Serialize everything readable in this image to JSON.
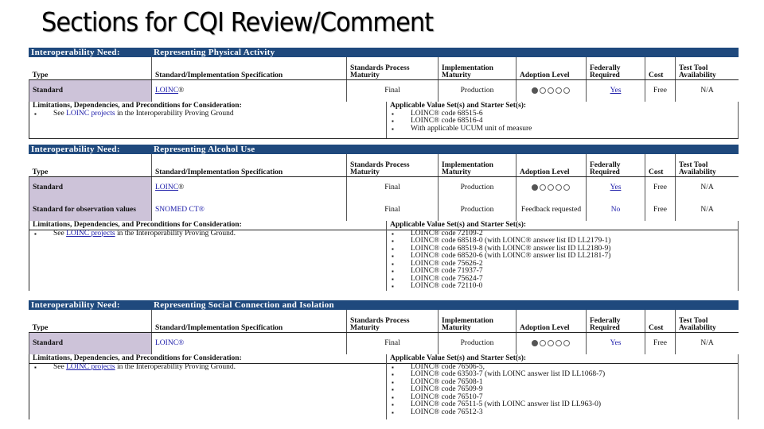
{
  "slide": {
    "title": "Sections for CQI Review/Comment"
  },
  "columns": [
    "Type",
    "Standard/Implementation Specification",
    "Standards Process Maturity",
    "Implementation Maturity",
    "Adoption Level",
    "Federally Required",
    "Cost",
    "Test Tool Availability"
  ],
  "limitations_header": "Limitations, Dependencies, and Preconditions for Consideration:",
  "value_sets_header": "Applicable Value Set(s) and Starter Set(s):",
  "colors": {
    "need_bar": "#1f497d",
    "type_cell": "#cdc3d9",
    "link": "#1a1aa8"
  },
  "sections": [
    {
      "need_label": "Interoperability Need:",
      "need_title": "Representing Physical Activity",
      "rows": [
        {
          "type": "Standard",
          "spec": "LOINC",
          "spec_suffix": "®",
          "process_maturity": "Final",
          "impl_maturity": "Production",
          "adoption": "1 of 5",
          "federally_required": "Yes",
          "cost": "Free",
          "test_tool": "N/A"
        }
      ],
      "limitations": [
        {
          "pre": "See ",
          "link": "LOINC projects",
          "post": " in the Interoperability Proving Ground"
        }
      ],
      "value_sets": [
        "LOINC® code 68515-6",
        "LOINC® code 68516-4",
        "With applicable UCUM unit of measure"
      ]
    },
    {
      "need_label": "Interoperability Need:",
      "need_title": "Representing Alcohol Use",
      "rows": [
        {
          "type": "Standard",
          "spec": "LOINC",
          "spec_suffix": "®",
          "process_maturity": "Final",
          "impl_maturity": "Production",
          "adoption": "1 of 5",
          "federally_required": "Yes",
          "cost": "Free",
          "test_tool": "N/A"
        },
        {
          "type": "Standard for observation values",
          "spec": "SNOMED CT®",
          "process_maturity": "Final",
          "impl_maturity": "Production",
          "adoption": "Feedback requested",
          "federally_required": "No",
          "cost": "Free",
          "test_tool": "N/A"
        }
      ],
      "limitations": [
        {
          "pre": "See ",
          "link": "LOINC projects",
          "post": " in the Interoperability Proving Ground."
        }
      ],
      "value_sets": [
        "LOINC® code 72109-2",
        "LOINC® code 68518-0 (with LOINC® answer list ID LL2179-1)",
        "LOINC® code 68519-8 (with LOINC® answer list ID LL2180-9)",
        "LOINC® code 68520-6 (with LOINC® answer list ID LL2181-7)",
        "LOINC® code 75626-2",
        "LOINC® code 71937-7",
        "LOINC® code 75624-7",
        "LOINC® code 72110-0"
      ]
    },
    {
      "need_label": "Interoperability Need:",
      "need_title": "Representing Social Connection and Isolation",
      "rows": [
        {
          "type": "Standard",
          "spec": "LOINC®",
          "process_maturity": "Final",
          "impl_maturity": "Production",
          "adoption": "1 of 5",
          "federally_required": "Yes",
          "cost": "Free",
          "test_tool": "N/A"
        }
      ],
      "limitations": [
        {
          "pre": "See ",
          "link": "LOINC projects",
          "post": " in the Interoperability Proving Ground."
        }
      ],
      "value_sets": [
        "LOINC® code 76506-5,",
        "LOINC® code 63503-7 (with LOINC answer list ID LL1068-7)",
        "LOINC® code 76508-1",
        "LOINC® code 76509-9",
        "LOINC® code  76510-7",
        "LOINC® code 76511-5 (with LOINC answer list ID LL963-0)",
        "LOINC® code 76512-3"
      ]
    }
  ]
}
